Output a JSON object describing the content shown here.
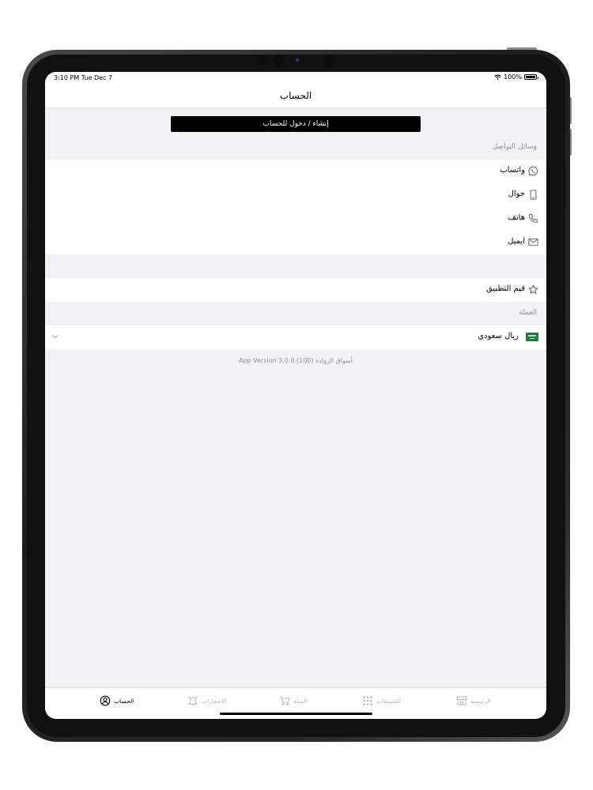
{
  "status": {
    "time": "3:10 PM  Tue Dec 7",
    "battery": "100%",
    "battery_level": 1.0
  },
  "nav": {
    "title": "الحساب"
  },
  "login_button": "إنشاء / دخول للحساب",
  "contact": {
    "section_label": "وسائل التواصل",
    "items": [
      {
        "label": "واتساب",
        "icon": "whatsapp-icon"
      },
      {
        "label": "جوال",
        "icon": "mobile-icon"
      },
      {
        "label": "هاتف",
        "icon": "phone-icon"
      },
      {
        "label": "ايميل",
        "icon": "mail-icon"
      }
    ]
  },
  "rate": {
    "label": "قيم التطبيق",
    "icon": "star-icon"
  },
  "currency": {
    "section_label": "العملة",
    "selected": "ريال سعودي",
    "icon": "saudi-flag-icon"
  },
  "version": "App Version 3.0.0.(100) أسواق الزوادة",
  "tabs": [
    {
      "label": "الحساب",
      "icon": "account-icon",
      "active": true
    },
    {
      "label": "الاشعارات",
      "icon": "bell-icon",
      "active": false
    },
    {
      "label": "السلة",
      "icon": "cart-icon",
      "active": false
    },
    {
      "label": "التصنيفات",
      "icon": "grid-icon",
      "active": false
    },
    {
      "label": "الرئيسية",
      "icon": "store-icon",
      "active": false
    }
  ],
  "colors": {
    "background": "#f2f2f6",
    "accent": "#000000",
    "inactive": "#b8b8bc",
    "flag_green": "#1f7a3b"
  }
}
